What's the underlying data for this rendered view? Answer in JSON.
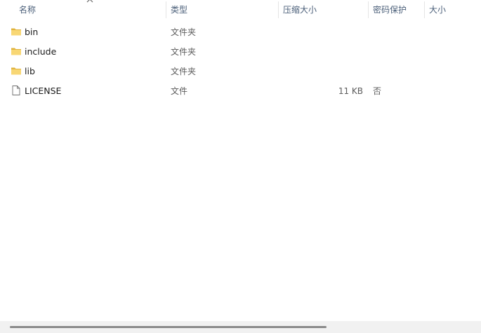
{
  "columns": {
    "name": "名称",
    "type": "类型",
    "compressed_size": "压缩大小",
    "password_protected": "密码保护",
    "size": "大小"
  },
  "sort": {
    "column": "name",
    "icon": "chevron-up-icon"
  },
  "files": [
    {
      "name": "bin",
      "type": "文件夹",
      "compressed_size": "",
      "password_protected": "",
      "icon": "folder-icon"
    },
    {
      "name": "include",
      "type": "文件夹",
      "compressed_size": "",
      "password_protected": "",
      "icon": "folder-icon"
    },
    {
      "name": "lib",
      "type": "文件夹",
      "compressed_size": "",
      "password_protected": "",
      "icon": "folder-icon"
    },
    {
      "name": "LICENSE",
      "type": "文件",
      "compressed_size": "11 KB",
      "password_protected": "否",
      "icon": "file-icon"
    }
  ],
  "colors": {
    "header_text": "#4c607a",
    "folder": "#f8d775",
    "folder_dark": "#e0b33c"
  }
}
